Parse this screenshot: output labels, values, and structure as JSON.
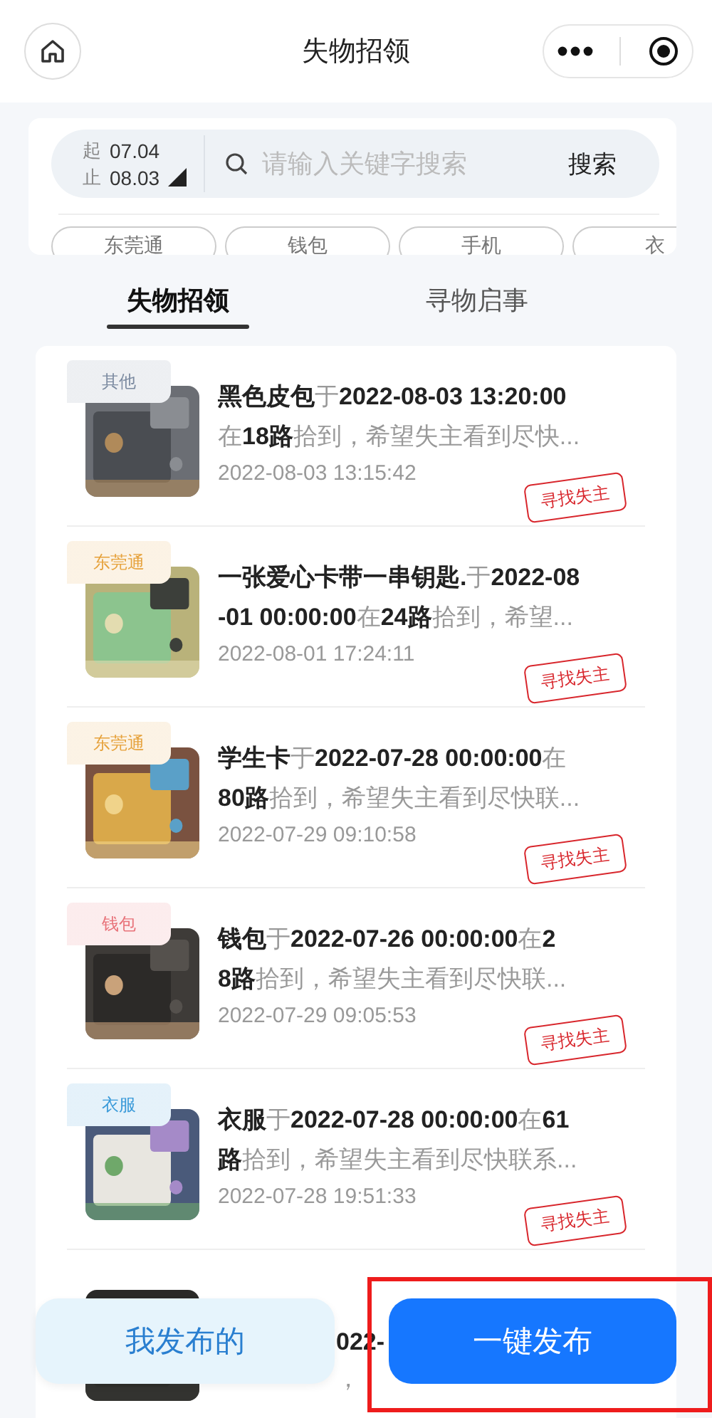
{
  "nav": {
    "title": "失物招领"
  },
  "filter": {
    "date_start_label": "起",
    "date_start": "07.04",
    "date_end_label": "止",
    "date_end": "08.03",
    "search_placeholder": "请输入关键字搜索",
    "search_button": "搜索"
  },
  "chips": [
    {
      "label": "东莞通"
    },
    {
      "label": "钱包"
    },
    {
      "label": "手机"
    },
    {
      "label": "衣"
    }
  ],
  "tabs": [
    {
      "label": "失物招领",
      "selected": true
    },
    {
      "label": "寻物启事",
      "selected": false
    }
  ],
  "items": [
    {
      "kind": "full",
      "category": "其他",
      "color": "#7b8aa0",
      "lines": [
        "**黑色皮包**于**2022-08-03 13:20:00**",
        "在**18路**拾到，希望失主看到尽快..."
      ],
      "time": "2022-08-03 13:15:42",
      "stamp": "寻找失主"
    },
    {
      "kind": "full",
      "category": "东莞通",
      "color": "#e6a23c",
      "lines": [
        "**一张爱心卡带一串钥匙.**于**2022-08**",
        "**-01 00:00:00**在**24路**拾到，希望..."
      ],
      "time": "2022-08-01 17:24:11",
      "stamp": "寻找失主"
    },
    {
      "kind": "full",
      "category": "东莞通",
      "color": "#e6a23c",
      "lines": [
        "**学生卡**于**2022-07-28 00:00:00**在",
        "**80路**拾到，希望失主看到尽快联..."
      ],
      "time": "2022-07-29 09:10:58",
      "stamp": "寻找失主"
    },
    {
      "kind": "full",
      "category": "钱包",
      "color": "#e8737a",
      "lines": [
        "**钱包**于**2022-07-26 00:00:00**在**2**",
        "**8路**拾到，希望失主看到尽快联..."
      ],
      "time": "2022-07-29 09:05:53",
      "stamp": "寻找失主"
    },
    {
      "kind": "full",
      "category": "衣服",
      "color": "#3a9ad9",
      "lines": [
        "**衣服**于**2022-07-28 00:00:00**在**61**",
        "**路**拾到，希望失主看到尽快联系..."
      ],
      "time": "2022-07-28 19:51:33",
      "stamp": "寻找失主"
    },
    {
      "kind": "partial",
      "lines": [
        "**022-**",
        "，"
      ]
    }
  ],
  "buttons": [
    {
      "label": "我发布的",
      "kind": "secondary"
    },
    {
      "label": "一键发布",
      "kind": "primary"
    }
  ],
  "annotation": {
    "kind": "rectangle"
  }
}
